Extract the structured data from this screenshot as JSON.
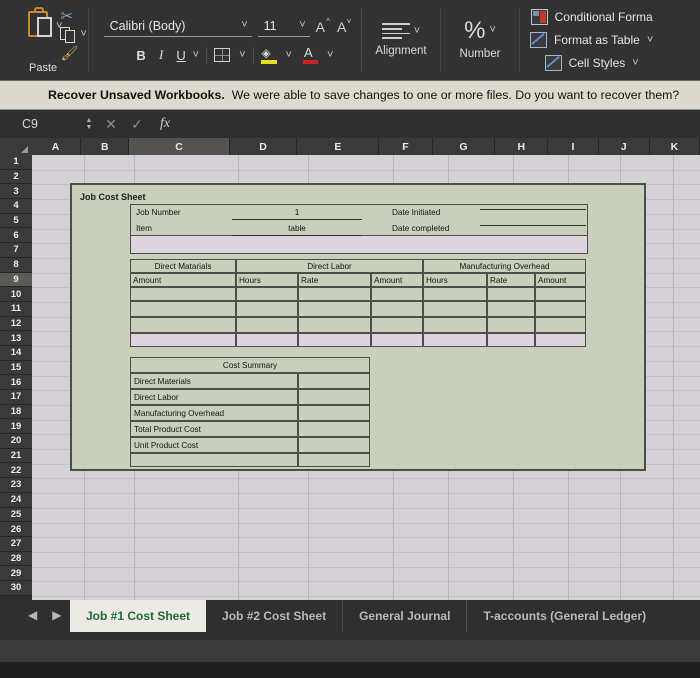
{
  "ribbon": {
    "paste": {
      "label": "Paste",
      "icon": "paste-icon",
      "cut_icon": "scissors-icon",
      "copy_icon": "copy-icon",
      "painter_icon": "format-painter-icon"
    },
    "font": {
      "name_value": "Calibri (Body)",
      "size_value": "11",
      "grow_label": "A",
      "shrink_label": "A",
      "bold_label": "B",
      "italic_label": "I",
      "underline_label": "U",
      "borders_icon": "borders-icon",
      "fill_color_label": "A",
      "font_color_label": "A",
      "fill_color": "#e2e21c",
      "font_color": "#cc2222"
    },
    "alignment": {
      "label": "Alignment"
    },
    "number": {
      "label": "Number",
      "symbol": "%"
    },
    "styles": [
      {
        "label": "Conditional Forma",
        "icon": "conditional-formatting-icon"
      },
      {
        "label": "Format as Table",
        "icon": "format-as-table-icon"
      },
      {
        "label": "Cell Styles",
        "icon": "cell-styles-icon"
      }
    ]
  },
  "message_bar": {
    "title": "Recover Unsaved Workbooks.",
    "text": "We were able to save changes to one or more files. Do you want to recover them?"
  },
  "formula_bar": {
    "name_box": "C9",
    "cancel_icon": "close-icon",
    "enter_icon": "check-icon",
    "function_icon": "fx",
    "formula_value": ""
  },
  "grid": {
    "columns": [
      "A",
      "B",
      "C",
      "D",
      "E",
      "F",
      "G",
      "H",
      "I",
      "J",
      "K"
    ],
    "selected_column": "C",
    "rows": [
      "1",
      "2",
      "3",
      "4",
      "5",
      "6",
      "7",
      "8",
      "9",
      "10",
      "11",
      "12",
      "13",
      "14",
      "15",
      "16",
      "17",
      "18",
      "19",
      "20",
      "21",
      "22",
      "23",
      "24",
      "25",
      "26",
      "27",
      "28",
      "29",
      "30"
    ],
    "selected_row": "9"
  },
  "job_cost_sheet": {
    "title": "Job Cost Sheet",
    "fields": [
      {
        "label": "Job Number",
        "value": "1"
      },
      {
        "label": "Item",
        "value": "table"
      },
      {
        "label": "Date Initiated",
        "value": ""
      },
      {
        "label": "Date completed",
        "value": ""
      }
    ],
    "cost_table": {
      "group_headers": [
        "Direct Matarials",
        "Direct Labor",
        "Manufacturing Overhead"
      ],
      "column_headers": [
        "Amount",
        "Hours",
        "Rate",
        "Amount",
        "Hours",
        "Rate",
        "Amount"
      ],
      "body_rows": 4
    },
    "cost_summary": {
      "title": "Cost Summary",
      "rows": [
        {
          "label": "Direct Materials",
          "value": ""
        },
        {
          "label": "Direct Labor",
          "value": ""
        },
        {
          "label": "Manufacturing Overhead",
          "value": ""
        },
        {
          "label": "Total Product Cost",
          "value": ""
        },
        {
          "label": "Unit Product Cost",
          "value": ""
        }
      ]
    }
  },
  "sheet_tabs": {
    "prev_icon": "prev-sheet-icon",
    "next_icon": "next-sheet-icon",
    "tabs": [
      {
        "label": "Job #1 Cost Sheet",
        "active": true
      },
      {
        "label": "Job #2 Cost Sheet",
        "active": false
      },
      {
        "label": "General Journal",
        "active": false
      },
      {
        "label": "T-accounts (General Ledger)",
        "active": false
      }
    ],
    "active_color": "#1e6b3a"
  }
}
